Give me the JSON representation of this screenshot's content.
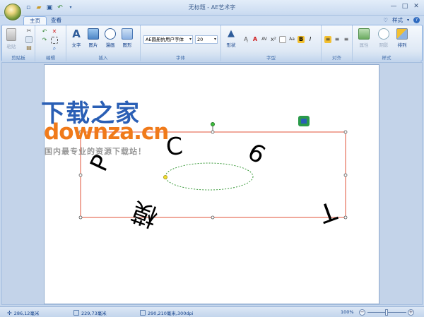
{
  "window": {
    "title": "无标题 - AE艺术字",
    "minimize": "—",
    "maximize": "□",
    "close": "✕"
  },
  "tabs": [
    {
      "label": "主页",
      "active": true
    },
    {
      "label": "查看",
      "active": false
    }
  ],
  "style_menu": {
    "label": "样式",
    "help": "?"
  },
  "ribbon": {
    "groups": {
      "clipboard": "剪贴板",
      "edit": "编辑",
      "insert": "插入",
      "font": "字体",
      "glyph": "字型",
      "align": "对齐",
      "style": "样式"
    },
    "buttons": {
      "paste": "粘贴",
      "text": "文字",
      "image": "图片",
      "comic": "漫画",
      "shape": "图形",
      "shape_style": "形状",
      "property": "属性",
      "shadow": "阴影",
      "arrange": "排列"
    },
    "font_name": "AE圆册抗用户字体",
    "font_size": "20"
  },
  "canvas": {
    "chars": [
      "P",
      "C",
      "6",
      "T",
      "模"
    ]
  },
  "watermark": {
    "cn": "下载之家",
    "en": "downza.cn",
    "sub": "国内最专业的资源下载站！"
  },
  "status": {
    "pos1": "286,12毫米",
    "pos2": "229,73毫米",
    "size": "290,210毫米,300dpi",
    "zoom": "100%"
  },
  "colors": {
    "selection": "#e0533a",
    "ellipse": "#3a9a3a",
    "accent_blue": "#2a5fb5",
    "accent_orange": "#f07a1a"
  }
}
